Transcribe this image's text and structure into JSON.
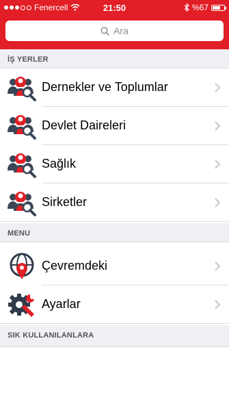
{
  "status_bar": {
    "carrier": "Fenercell",
    "time": "21:50",
    "battery": "%67",
    "battery_level": 0.67
  },
  "search": {
    "placeholder": "Ara",
    "icon": "search-icon"
  },
  "sections": [
    {
      "title": "İŞ YERLER"
    },
    {
      "title": "MENU"
    },
    {
      "title": "SIK KULLANILANLARA"
    }
  ],
  "work_items": [
    {
      "label": "Dernekler ve Toplumlar",
      "icon": "people-search-icon"
    },
    {
      "label": "Devlet Daireleri",
      "icon": "people-search-icon"
    },
    {
      "label": "Sağlık",
      "icon": "people-search-icon"
    },
    {
      "label": "Sirketler",
      "icon": "people-search-icon"
    }
  ],
  "menu_items": [
    {
      "label": "Çevremdeki",
      "icon": "globe-pin-icon"
    },
    {
      "label": "Ayarlar",
      "icon": "gear-wrench-icon"
    }
  ],
  "colors": {
    "brand": "#e21f26",
    "section_bg": "#efeff4",
    "icon_dark": "#2f3b4a"
  }
}
